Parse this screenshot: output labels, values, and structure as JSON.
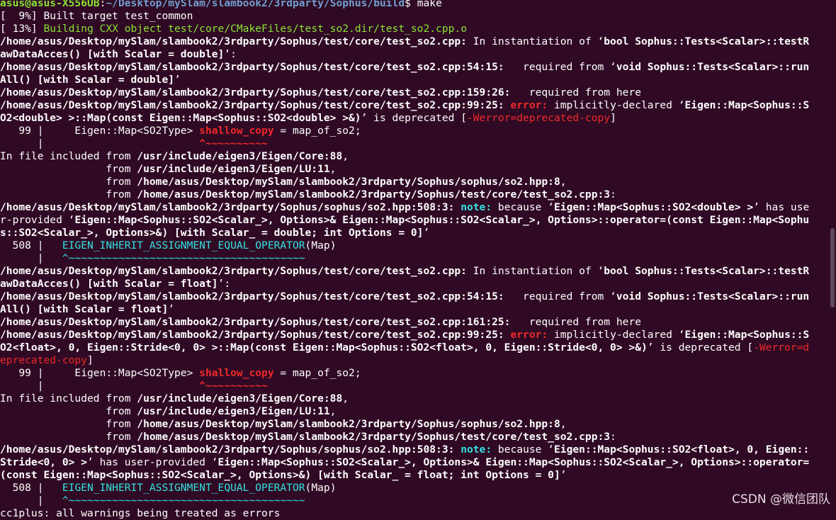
{
  "terminal": {
    "lines": [
      [
        {
          "t": "asus@asus-X556UB",
          "c": "g b"
        },
        {
          "t": ":",
          "c": ""
        },
        {
          "t": "~/Desktop/mySlam/slambook2/3rdparty/Sophus/build",
          "c": "bl b"
        },
        {
          "t": "$ make",
          "c": ""
        }
      ],
      [
        {
          "t": "[  9%] Built target test_common",
          "c": ""
        }
      ],
      [
        {
          "t": "[ 13%] ",
          "c": ""
        },
        {
          "t": "Building CXX object test/core/CMakeFiles/test_so2.dir/test_so2.cpp.o",
          "c": "g"
        }
      ],
      [
        {
          "t": "/home/asus/Desktop/mySlam/slambook2/3rdparty/Sophus/test/core/test_so2.cpp:",
          "c": "b"
        },
        {
          "t": " In instantiation of ‘",
          "c": ""
        },
        {
          "t": "bool Sophus::Tests<Scalar>::testR",
          "c": "b"
        }
      ],
      [
        {
          "t": "awDataAcces() [with Scalar = double]",
          "c": "b"
        },
        {
          "t": "’:",
          "c": ""
        }
      ],
      [
        {
          "t": "/home/asus/Desktop/mySlam/slambook2/3rdparty/Sophus/test/core/test_so2.cpp:54:15:",
          "c": "b"
        },
        {
          "t": "   required from ‘",
          "c": ""
        },
        {
          "t": "void Sophus::Tests<Scalar>::run",
          "c": "b"
        }
      ],
      [
        {
          "t": "All() [with Scalar = double]",
          "c": "b"
        },
        {
          "t": "’",
          "c": ""
        }
      ],
      [
        {
          "t": "/home/asus/Desktop/mySlam/slambook2/3rdparty/Sophus/test/core/test_so2.cpp:159:26:",
          "c": "b"
        },
        {
          "t": "   required from here",
          "c": ""
        }
      ],
      [
        {
          "t": "/home/asus/Desktop/mySlam/slambook2/3rdparty/Sophus/test/core/test_so2.cpp:99:25:",
          "c": "b"
        },
        {
          "t": " ",
          "c": ""
        },
        {
          "t": "error:",
          "c": "r b"
        },
        {
          "t": " implicitly-declared ‘",
          "c": ""
        },
        {
          "t": "Eigen::Map<Sophus::S",
          "c": "b"
        }
      ],
      [
        {
          "t": "O2<double> >::Map(const Eigen::Map<Sophus::SO2<double> >&)",
          "c": "b"
        },
        {
          "t": "’ is deprecated [",
          "c": ""
        },
        {
          "t": "-Werror=deprecated-copy",
          "c": "r"
        },
        {
          "t": "]",
          "c": ""
        }
      ],
      [
        {
          "t": "   99 |     Eigen::Map<SO2Type> ",
          "c": ""
        },
        {
          "t": "shallow_copy",
          "c": "r b"
        },
        {
          "t": " = map_of_so2;",
          "c": ""
        }
      ],
      [
        {
          "t": "      |                         ",
          "c": ""
        },
        {
          "t": "^~~~~~~~~~~",
          "c": "r b"
        }
      ],
      [
        {
          "t": "In file included from ",
          "c": ""
        },
        {
          "t": "/usr/include/eigen3/Eigen/Core:88",
          "c": "b"
        },
        {
          "t": ",",
          "c": ""
        }
      ],
      [
        {
          "t": "                 from ",
          "c": ""
        },
        {
          "t": "/usr/include/eigen3/Eigen/LU:11",
          "c": "b"
        },
        {
          "t": ",",
          "c": ""
        }
      ],
      [
        {
          "t": "                 from ",
          "c": ""
        },
        {
          "t": "/home/asus/Desktop/mySlam/slambook2/3rdparty/Sophus/sophus/so2.hpp:8",
          "c": "b"
        },
        {
          "t": ",",
          "c": ""
        }
      ],
      [
        {
          "t": "                 from ",
          "c": ""
        },
        {
          "t": "/home/asus/Desktop/mySlam/slambook2/3rdparty/Sophus/test/core/test_so2.cpp:3",
          "c": "b"
        },
        {
          "t": ":",
          "c": ""
        }
      ],
      [
        {
          "t": "/home/asus/Desktop/mySlam/slambook2/3rdparty/Sophus/sophus/so2.hpp:508:3:",
          "c": "b"
        },
        {
          "t": " ",
          "c": ""
        },
        {
          "t": "note:",
          "c": "c b"
        },
        {
          "t": " because ‘",
          "c": ""
        },
        {
          "t": "Eigen::Map<Sophus::SO2<double> >",
          "c": "b"
        },
        {
          "t": "’ has use",
          "c": ""
        }
      ],
      [
        {
          "t": "r-provided ‘",
          "c": ""
        },
        {
          "t": "Eigen::Map<Sophus::SO2<Scalar_>, Options>& Eigen::Map<Sophus::SO2<Scalar_>, Options>::operator=(const Eigen::Map<Sophu",
          "c": "b"
        }
      ],
      [
        {
          "t": "s::SO2<Scalar_>, Options>&) [with Scalar_ = double; int Options = 0]",
          "c": "b"
        },
        {
          "t": "’",
          "c": ""
        }
      ],
      [
        {
          "t": "  508 |   ",
          "c": ""
        },
        {
          "t": "EIGEN_INHERIT_ASSIGNMENT_EQUAL_OPERATOR",
          "c": "c"
        },
        {
          "t": "(Map)",
          "c": ""
        }
      ],
      [
        {
          "t": "      |   ",
          "c": ""
        },
        {
          "t": "^~~~~~~~~~~~~~~~~~~~~~~~~~~~~~~~~~~~~~~",
          "c": "c"
        }
      ],
      [
        {
          "t": "/home/asus/Desktop/mySlam/slambook2/3rdparty/Sophus/test/core/test_so2.cpp:",
          "c": "b"
        },
        {
          "t": " In instantiation of ‘",
          "c": ""
        },
        {
          "t": "bool Sophus::Tests<Scalar>::testR",
          "c": "b"
        }
      ],
      [
        {
          "t": "awDataAcces() [with Scalar = float]",
          "c": "b"
        },
        {
          "t": "’:",
          "c": ""
        }
      ],
      [
        {
          "t": "/home/asus/Desktop/mySlam/slambook2/3rdparty/Sophus/test/core/test_so2.cpp:54:15:",
          "c": "b"
        },
        {
          "t": "   required from ‘",
          "c": ""
        },
        {
          "t": "void Sophus::Tests<Scalar>::run",
          "c": "b"
        }
      ],
      [
        {
          "t": "All() [with Scalar = float]",
          "c": "b"
        },
        {
          "t": "’",
          "c": ""
        }
      ],
      [
        {
          "t": "/home/asus/Desktop/mySlam/slambook2/3rdparty/Sophus/test/core/test_so2.cpp:161:25:",
          "c": "b"
        },
        {
          "t": "   required from here",
          "c": ""
        }
      ],
      [
        {
          "t": "/home/asus/Desktop/mySlam/slambook2/3rdparty/Sophus/test/core/test_so2.cpp:99:25:",
          "c": "b"
        },
        {
          "t": " ",
          "c": ""
        },
        {
          "t": "error:",
          "c": "r b"
        },
        {
          "t": " implicitly-declared ‘",
          "c": ""
        },
        {
          "t": "Eigen::Map<Sophus::S",
          "c": "b"
        }
      ],
      [
        {
          "t": "O2<float>, 0, Eigen::Stride<0, 0> >::Map(const Eigen::Map<Sophus::SO2<float>, 0, Eigen::Stride<0, 0> >&)",
          "c": "b"
        },
        {
          "t": "’ is deprecated [",
          "c": ""
        },
        {
          "t": "-Werror=d",
          "c": "r"
        }
      ],
      [
        {
          "t": "eprecated-copy",
          "c": "r"
        },
        {
          "t": "]",
          "c": ""
        }
      ],
      [
        {
          "t": "   99 |     Eigen::Map<SO2Type> ",
          "c": ""
        },
        {
          "t": "shallow_copy",
          "c": "r b"
        },
        {
          "t": " = map_of_so2;",
          "c": ""
        }
      ],
      [
        {
          "t": "      |                         ",
          "c": ""
        },
        {
          "t": "^~~~~~~~~~~",
          "c": "r b"
        }
      ],
      [
        {
          "t": "In file included from ",
          "c": ""
        },
        {
          "t": "/usr/include/eigen3/Eigen/Core:88",
          "c": "b"
        },
        {
          "t": ",",
          "c": ""
        }
      ],
      [
        {
          "t": "                 from ",
          "c": ""
        },
        {
          "t": "/usr/include/eigen3/Eigen/LU:11",
          "c": "b"
        },
        {
          "t": ",",
          "c": ""
        }
      ],
      [
        {
          "t": "                 from ",
          "c": ""
        },
        {
          "t": "/home/asus/Desktop/mySlam/slambook2/3rdparty/Sophus/sophus/so2.hpp:8",
          "c": "b"
        },
        {
          "t": ",",
          "c": ""
        }
      ],
      [
        {
          "t": "                 from ",
          "c": ""
        },
        {
          "t": "/home/asus/Desktop/mySlam/slambook2/3rdparty/Sophus/test/core/test_so2.cpp:3",
          "c": "b"
        },
        {
          "t": ":",
          "c": ""
        }
      ],
      [
        {
          "t": "/home/asus/Desktop/mySlam/slambook2/3rdparty/Sophus/sophus/so2.hpp:508:3:",
          "c": "b"
        },
        {
          "t": " ",
          "c": ""
        },
        {
          "t": "note:",
          "c": "c b"
        },
        {
          "t": " because ‘",
          "c": ""
        },
        {
          "t": "Eigen::Map<Sophus::SO2<float>, 0, Eigen::",
          "c": "b"
        }
      ],
      [
        {
          "t": "Stride<0, 0> >",
          "c": "b"
        },
        {
          "t": "’ has user-provided ‘",
          "c": ""
        },
        {
          "t": "Eigen::Map<Sophus::SO2<Scalar_>, Options>& Eigen::Map<Sophus::SO2<Scalar_>, Options>::operator=",
          "c": "b"
        }
      ],
      [
        {
          "t": "(const Eigen::Map<Sophus::SO2<Scalar_>, Options>&) [with Scalar_ = float; int Options = 0]",
          "c": "b"
        },
        {
          "t": "’",
          "c": ""
        }
      ],
      [
        {
          "t": "  508 |   ",
          "c": ""
        },
        {
          "t": "EIGEN_INHERIT_ASSIGNMENT_EQUAL_OPERATOR",
          "c": "c"
        },
        {
          "t": "(Map)",
          "c": ""
        }
      ],
      [
        {
          "t": "      |   ",
          "c": ""
        },
        {
          "t": "^~~~~~~~~~~~~~~~~~~~~~~~~~~~~~~~~~~~~~~",
          "c": "c"
        }
      ],
      [
        {
          "t": "cc1plus: all warnings being treated as errors",
          "c": ""
        }
      ]
    ]
  },
  "watermark": "CSDN @微信团队",
  "colors": {
    "background": "#300a24",
    "text": "#ffffff",
    "prompt_user": "#8ae234",
    "prompt_path": "#729fcf",
    "error": "#ef2929",
    "note": "#34e2e2"
  }
}
